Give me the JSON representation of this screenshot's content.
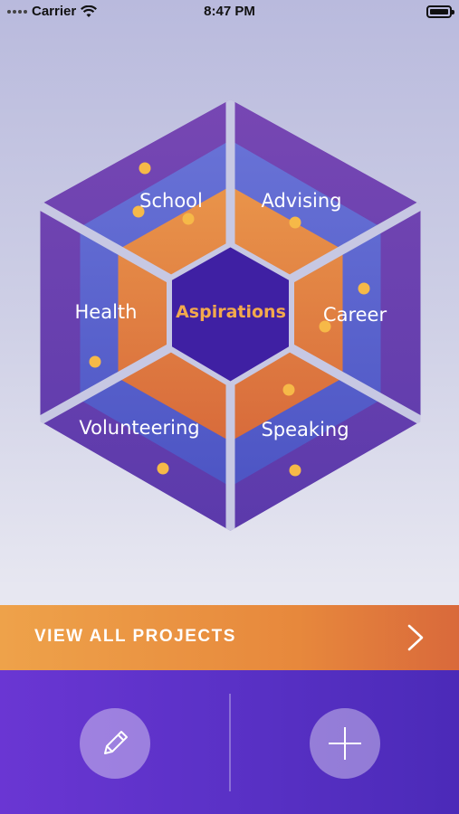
{
  "status_bar": {
    "carrier": "Carrier",
    "time": "8:47 PM",
    "icons": [
      "signal-icon",
      "wifi-icon",
      "battery-icon"
    ]
  },
  "hexagon": {
    "center_label": "Aspirations",
    "segments": [
      {
        "label": "School"
      },
      {
        "label": "Advising"
      },
      {
        "label": "Career"
      },
      {
        "label": "Speaking"
      },
      {
        "label": "Volunteering"
      },
      {
        "label": "Health"
      }
    ],
    "colors": {
      "outer_ring": "#6a45b8",
      "middle_ring": "#5b62cf",
      "inner_ring": "#e07f42",
      "center": "#3f20a3",
      "dot": "#f6b948",
      "center_text": "#f3a94d"
    }
  },
  "view_all": {
    "label": "VIEW ALL PROJECTS",
    "icon": "chevron-right-icon"
  },
  "toolbar": {
    "edit_icon": "pencil-icon",
    "add_icon": "plus-icon"
  }
}
